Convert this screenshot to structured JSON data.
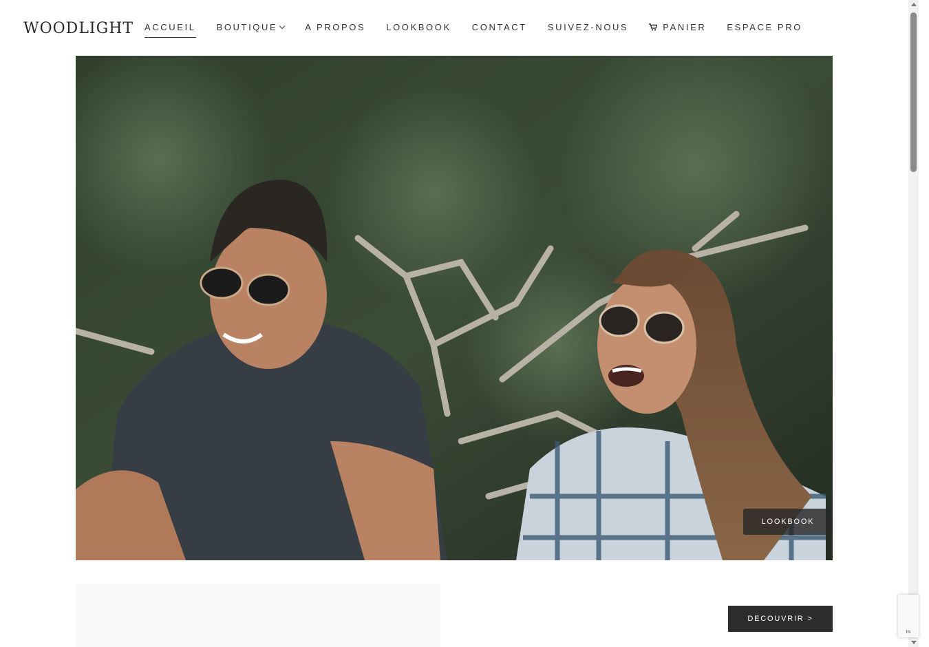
{
  "header": {
    "logo": "WOODLIGHT",
    "nav": [
      {
        "label": "ACCUEIL",
        "active": true
      },
      {
        "label": "BOUTIQUE",
        "has_dropdown": true
      },
      {
        "label": "A PROPOS"
      },
      {
        "label": "LOOKBOOK"
      },
      {
        "label": "CONTACT"
      },
      {
        "label": "SUIVEZ-NOUS"
      },
      {
        "label": "PANIER",
        "icon": "cart-icon"
      },
      {
        "label": "ESPACE PRO"
      }
    ]
  },
  "hero": {
    "image": "hero-photo",
    "tag_label": "LOOKBOOK"
  },
  "section": {
    "button_label": "DECOUVRIR >"
  },
  "recaptcha": {
    "label": "tis"
  },
  "colors": {
    "nav_text": "#333333",
    "button_bg": "#2d2d2d",
    "panel_bg": "#f6f8f9"
  }
}
